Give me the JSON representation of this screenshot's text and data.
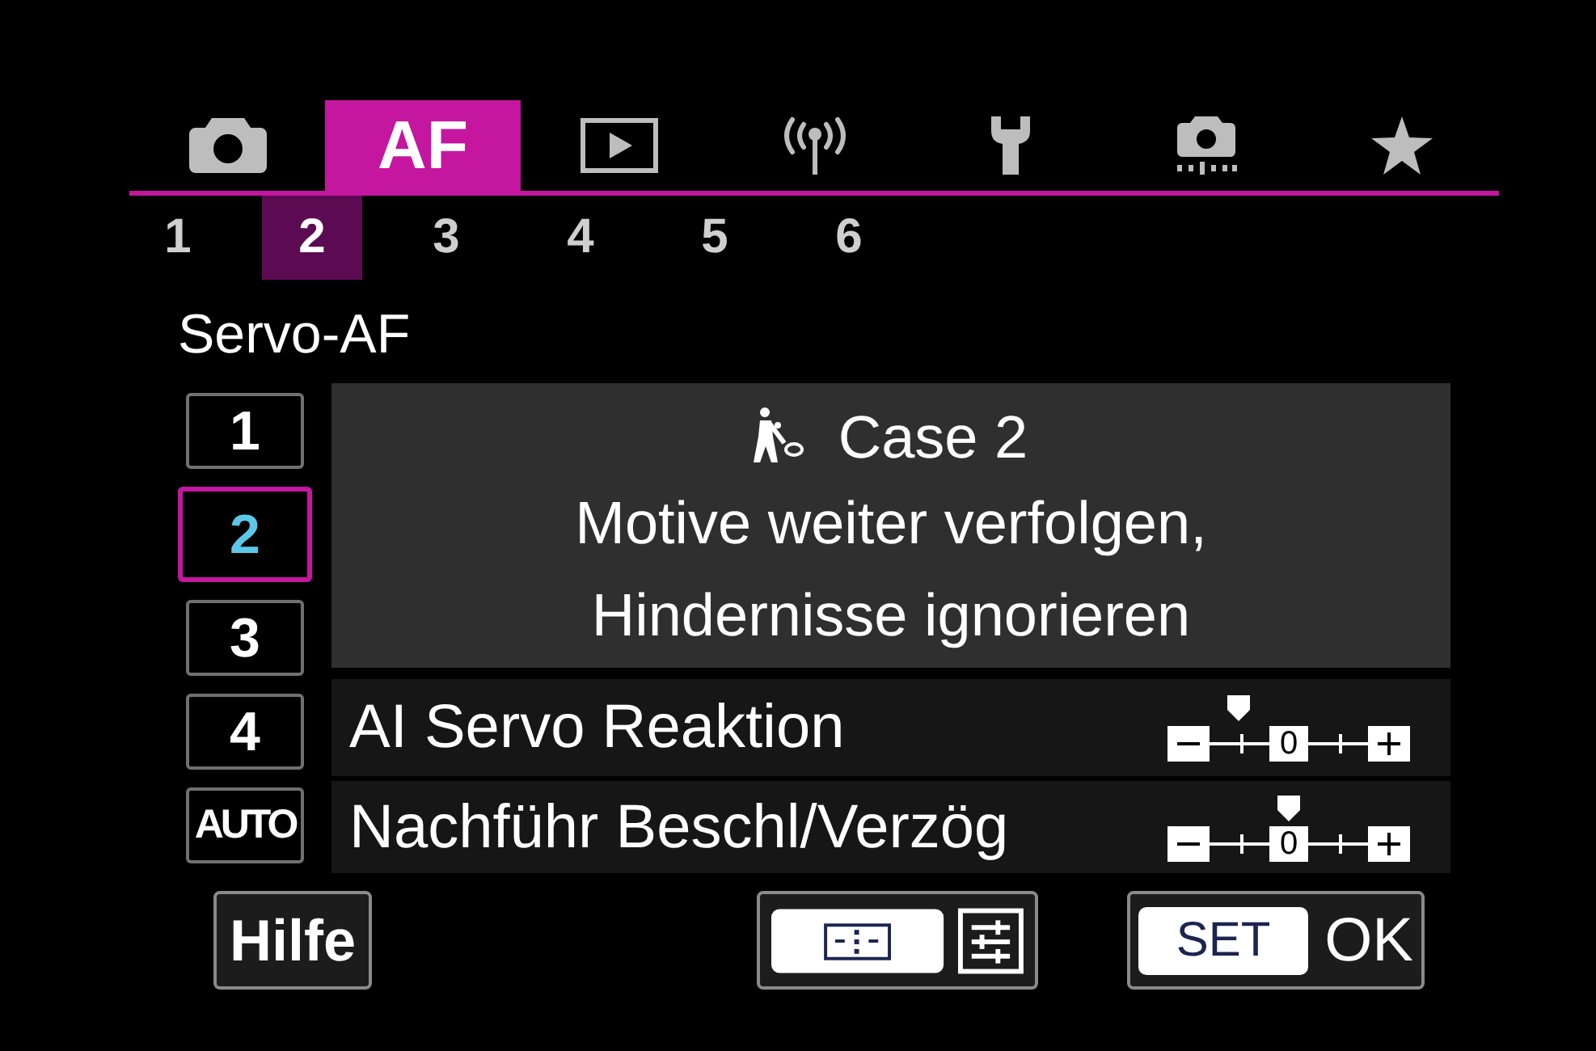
{
  "menu_tabs": [
    {
      "kind": "shooting",
      "selected": false
    },
    {
      "kind": "af",
      "label": "AF",
      "selected": true
    },
    {
      "kind": "playback",
      "selected": false
    },
    {
      "kind": "wireless",
      "selected": false
    },
    {
      "kind": "setup",
      "selected": false
    },
    {
      "kind": "custom",
      "selected": false
    },
    {
      "kind": "my_menu",
      "selected": false
    }
  ],
  "pages": [
    {
      "label": "1",
      "selected": false
    },
    {
      "label": "2",
      "selected": true
    },
    {
      "label": "3",
      "selected": false
    },
    {
      "label": "4",
      "selected": false
    },
    {
      "label": "5",
      "selected": false
    },
    {
      "label": "6",
      "selected": false
    }
  ],
  "title": "Servo-AF",
  "cases": [
    {
      "label": "1",
      "selected": false
    },
    {
      "label": "2",
      "selected": true
    },
    {
      "label": "3",
      "selected": false
    },
    {
      "label": "4",
      "selected": false
    },
    {
      "label": "AUTO",
      "selected": false
    }
  ],
  "case_detail": {
    "title": "Case 2",
    "description_lines": [
      "Motive weiter verfolgen,",
      "Hindernisse ignorieren"
    ]
  },
  "parameters": [
    {
      "label": "AI Servo Reaktion",
      "level": 0.25,
      "scale_zero": "0"
    },
    {
      "label": "Nachführ Beschl/Verzög",
      "level": 0.5,
      "scale_zero": "0"
    }
  ],
  "footer_buttons": [
    {
      "kind": "help",
      "label": "Hilfe"
    },
    {
      "kind": "af_area"
    },
    {
      "kind": "confirm",
      "key": "SET",
      "label": "OK"
    }
  ]
}
